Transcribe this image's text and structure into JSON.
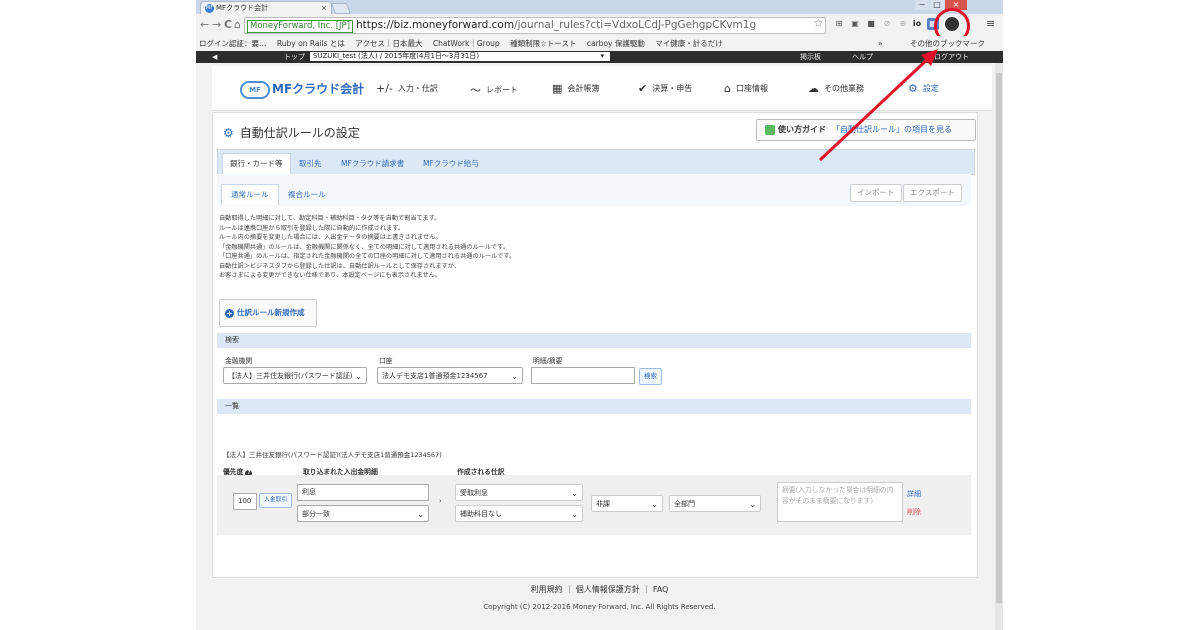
{
  "browser": {
    "tab_title": "MFクラウド会計",
    "tab_favicon": "MF",
    "tab_close": "×",
    "url_ev_label": "MoneyForward, Inc. [JP]",
    "url_scheme_host": "https://biz.moneyforward.com",
    "url_path": "/journal_rules?cti=VdxoLCdJ-PgGehgpCKvm1g",
    "back_icon": "←",
    "forward_icon": "→",
    "reload_icon": "C",
    "home_icon": "⌂",
    "star_icon": "☆",
    "menu_icon": "≡",
    "ext_icons": [
      "⊞",
      "▣",
      "■",
      "⊘",
      "⊕",
      "io",
      "▦"
    ],
    "win_min": "−",
    "win_max": "□",
    "win_close": "×"
  },
  "bookmarks": {
    "items": [
      "ログイン認証：要…",
      "Ruby on Rails とは",
      "アクセス｜日本最大",
      "ChatWork｜Group",
      "種類制限☆トースト",
      "carboy 保護駆動",
      "マイ健康・計るだけ"
    ],
    "more": "»",
    "other": "その他のブックマーク"
  },
  "app_bar": {
    "back": "◀",
    "breadcrumb": "トップ",
    "company_select": "SUZUKI_test (法人) / 2015年度(4月1日〜3月31日)",
    "right_items": [
      "掲示板",
      "ヘルプ",
      "ログアウト"
    ]
  },
  "header": {
    "logo": "MFクラウド会計",
    "logo_mark": "MF",
    "nav": [
      {
        "icon": "+/-",
        "label": "入力・仕訳"
      },
      {
        "icon": "〜",
        "label": "レポート"
      },
      {
        "icon": "▦",
        "label": "会計帳簿"
      },
      {
        "icon": "✔",
        "label": "決算・申告"
      },
      {
        "icon": "⌂",
        "label": "口座情報"
      },
      {
        "icon": "☁",
        "label": "その他業務"
      },
      {
        "icon": "⚙",
        "label": "設定"
      }
    ]
  },
  "page": {
    "title": "自動仕訳ルールの設定",
    "guide_label": "使い方ガイド",
    "guide_link": "「自動仕訳ルール」の項目を見る",
    "main_tabs": [
      "銀行・カード等",
      "取引先",
      "MFクラウド請求書",
      "MFクラウド給与"
    ],
    "sub_tabs": [
      "通常ルール",
      "複合ルール"
    ],
    "import_label": "インポート",
    "export_label": "エクスポート",
    "description": [
      "自動取得した明細に対して、勘定科目・補助科目・タグ等を自動で割当てます。",
      "ルールは連携口座から取引を登録した際に自動的に作成されます。",
      "ルール内の摘要を変更した場合には、入出金データの摘要は上書きされません。",
      "「金融機関共通」のルールは、金融機関に関係なく、全ての明細に対して適用される共通のルールです。",
      "「口座共通」のルールは、指定された金融機関の全ての口座の明細に対して適用される共通のルールです。",
      "自動仕訳＞ビジネスタブから登録した仕訳は、自動仕訳ルールとして保存されますが、",
      "お客さまによる変更ができない仕様であり、本設定ページにも表示されません。"
    ],
    "new_rule_label": "仕訳ルール新規作成",
    "search_section": "検索",
    "bank_label": "金融機関",
    "bank_value": "【法人】三井住友銀行(パスワード認証)",
    "account_label": "口座",
    "account_value": "法人デモ支店1普通預金1234567",
    "memo_label": "明細/摘要",
    "memo_value": "",
    "search_button": "検索",
    "list_section": "一覧",
    "group_title": "【法人】三井住友銀行(パスワード認証)(法人デモ支店1普通預金1234567)",
    "col_priority": "優先度",
    "col_imported": "取り込まれた入出金明細",
    "col_created": "作成される仕訳",
    "rule": {
      "priority": "100",
      "type_badge": "入金取引",
      "keyword": "利息",
      "match": "部分一致",
      "account": "受取利息",
      "sub_account": "補助科目なし",
      "tax": "非課",
      "dept": "全部門",
      "memo_placeholder": "摘要(入力しなかった場合は明細の内容がそのまま摘要になります)",
      "edit": "詳細",
      "delete": "削除"
    }
  },
  "footer": {
    "links": [
      "利用規約",
      "個人情報保護方針",
      "FAQ"
    ],
    "copyright": "Copyright (C) 2012-2016 Money Forward, Inc. All Rights Reserved."
  },
  "colors": {
    "accent": "#2e6bbd",
    "annotation_red": "#e0102a",
    "tab_bg": "#dce8f5"
  }
}
